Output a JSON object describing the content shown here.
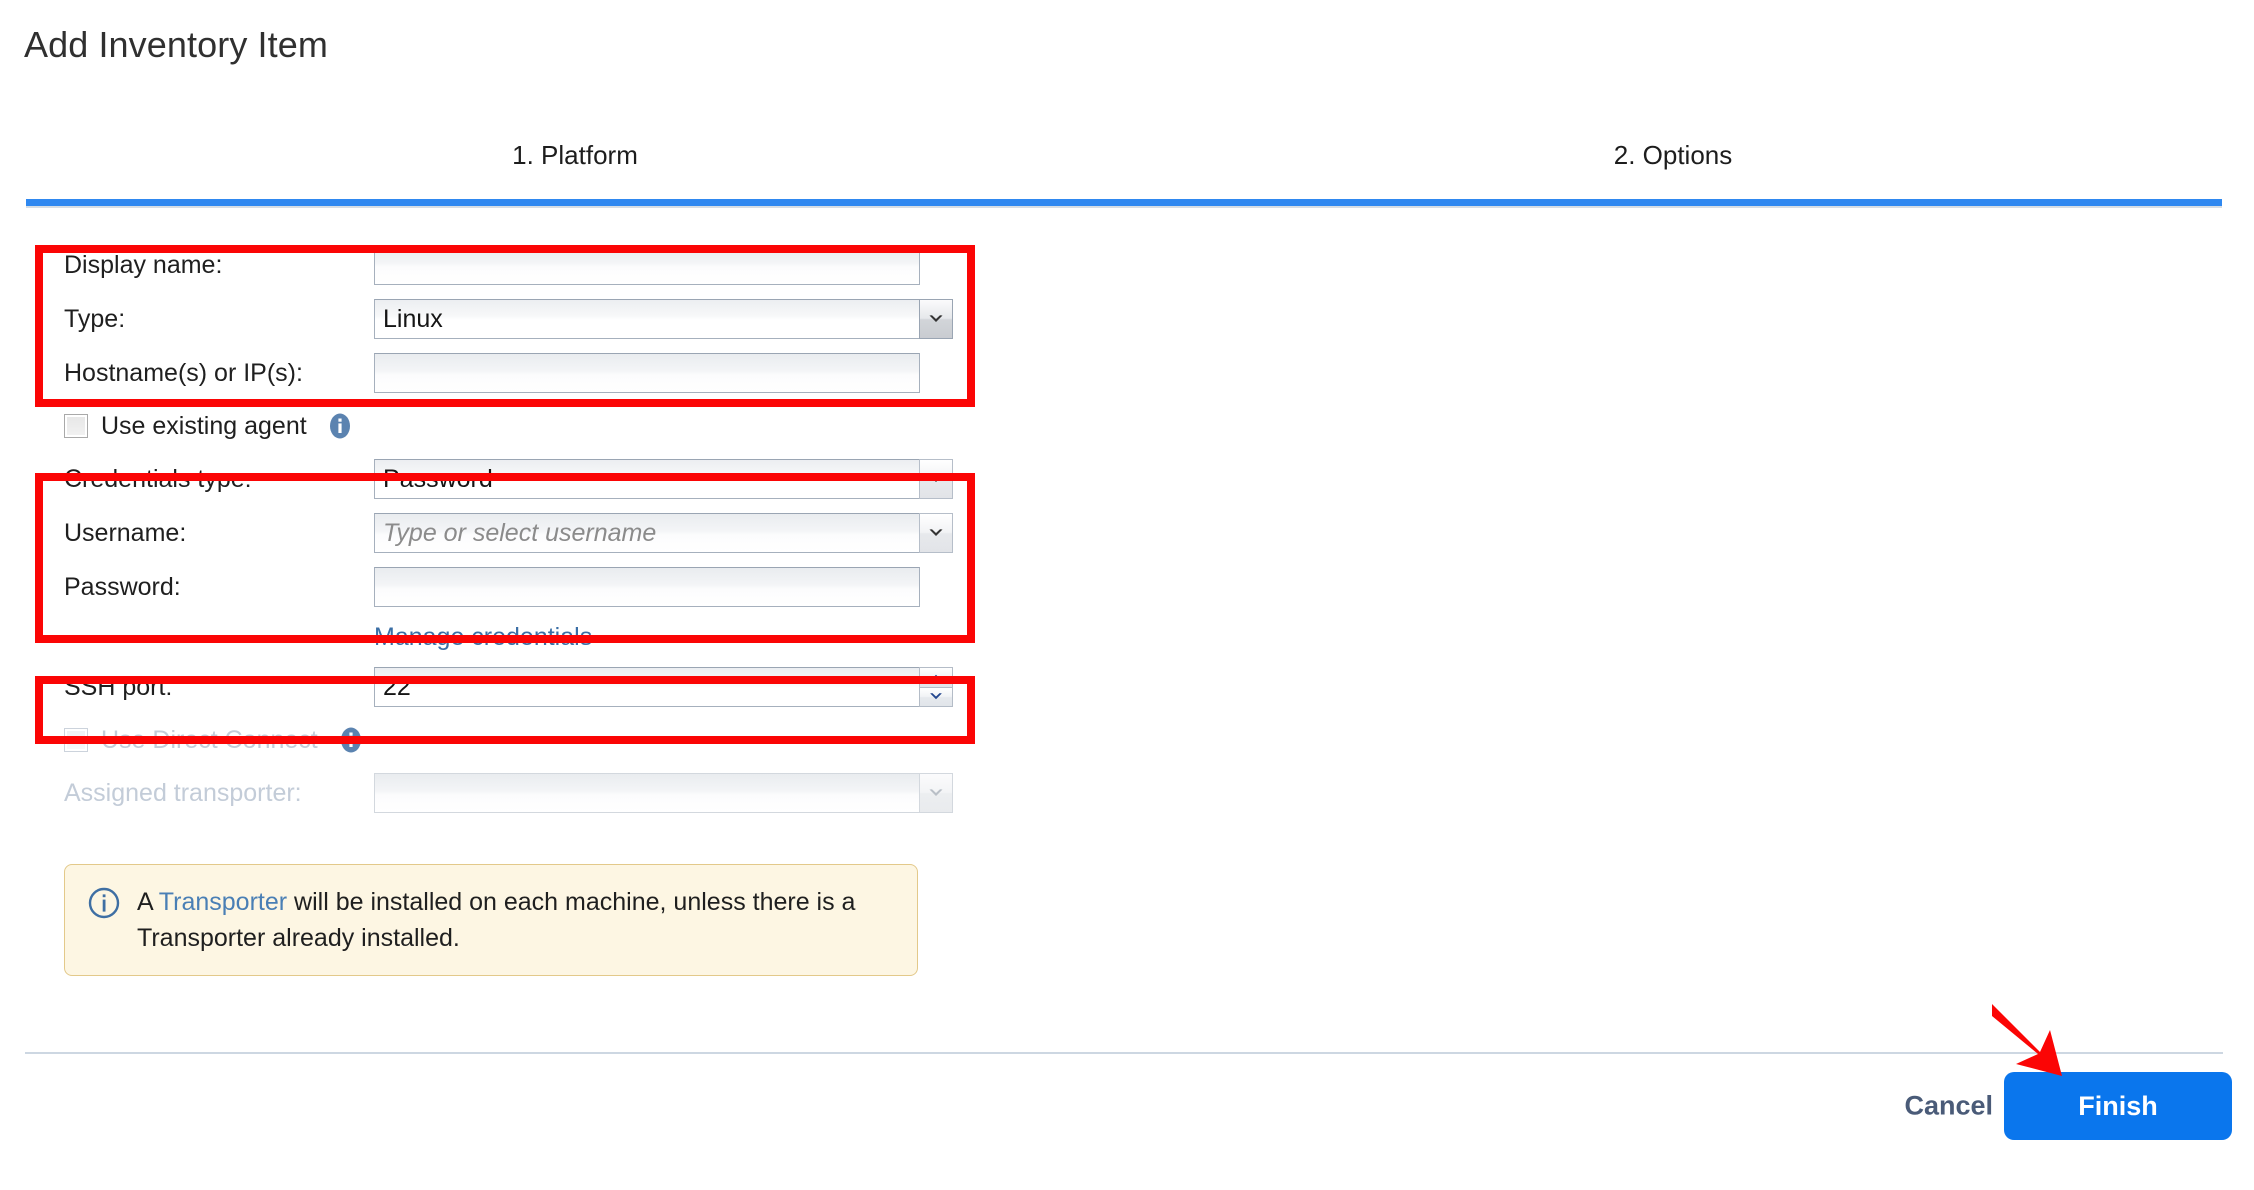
{
  "page_title": "Add Inventory Item",
  "wizard": {
    "tabs": [
      {
        "label": "1. Platform",
        "active": true
      },
      {
        "label": "2. Options",
        "active": false
      }
    ],
    "accent_color": "#2f88f0"
  },
  "form": {
    "display_name": {
      "label": "Display name:",
      "value": "",
      "placeholder": ""
    },
    "type": {
      "label": "Type:",
      "value": "Linux",
      "options": [
        "Linux"
      ]
    },
    "hostnames": {
      "label": "Hostname(s) or IP(s):",
      "value": "",
      "placeholder": ""
    },
    "use_existing_agent": {
      "label": "Use existing agent",
      "checked": false,
      "info_icon": "info-circle-icon"
    },
    "credentials_type": {
      "label": "Credentials type:",
      "value": "Password",
      "options": [
        "Password"
      ]
    },
    "username": {
      "label": "Username:",
      "value": "",
      "placeholder": "Type or select username"
    },
    "password": {
      "label": "Password:",
      "value": "",
      "placeholder": ""
    },
    "manage_credentials_link": "Manage credentials",
    "ssh_port": {
      "label": "SSH port:",
      "value": "22"
    },
    "use_direct_connect": {
      "label": "Use Direct Connect",
      "checked": false,
      "disabled": true,
      "info_icon": "info-circle-icon"
    },
    "assigned_transporter": {
      "label": "Assigned transporter:",
      "value": "",
      "disabled": true
    }
  },
  "callout": {
    "icon": "info-circle-outline-icon",
    "text_before": "A ",
    "link_text": "Transporter",
    "text_after": " will be installed on each machine, unless there is a Transporter already installed.",
    "background": "#fdf6e3",
    "border": "#e3c98a"
  },
  "footer": {
    "cancel_label": "Cancel",
    "finish_label": "Finish",
    "finish_color": "#0a76ed"
  },
  "annotations": {
    "highlight_color": "#fb0505",
    "arrow_target": "finish-button"
  }
}
